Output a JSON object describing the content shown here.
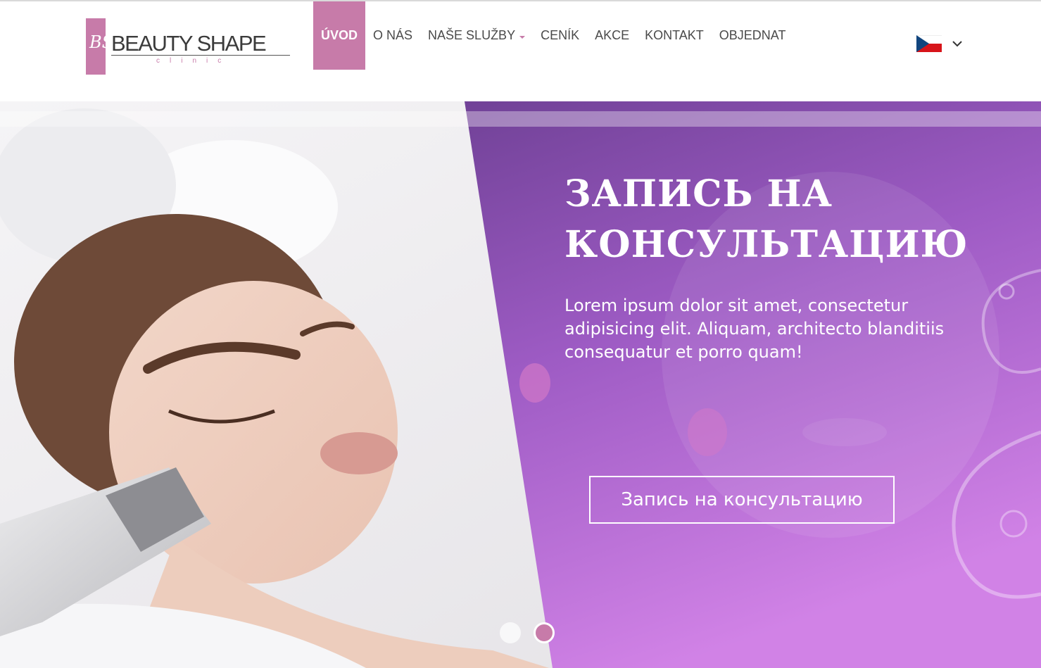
{
  "brand": {
    "monogram": "BS",
    "name": "BEAUTY SHAPE",
    "sub": "clinic",
    "accent_color": "#c77ba9"
  },
  "nav": {
    "items": [
      {
        "label": "ÚVOD",
        "active": true
      },
      {
        "label": "O NÁS"
      },
      {
        "label": "NAŠE SLUŽBY",
        "dropdown": true
      },
      {
        "label": "CENÍK"
      },
      {
        "label": "AKCE"
      },
      {
        "label": "KONTAKT"
      },
      {
        "label": "OBJEDNAT"
      }
    ]
  },
  "language": {
    "flag": "czech-flag-icon",
    "chevron": "chevron-down-icon"
  },
  "hero": {
    "title": "ЗАПИСЬ НА КОНСУЛЬТАЦИЮ",
    "text": "Lorem ipsum dolor sit amet, consectetur adipisicing elit. Aliquam, architecto blanditiis consequatur et porro quam!",
    "button": "Запись на консультацию",
    "overlay_color": "#8f47b8",
    "slides_total": 2,
    "active_slide": 2
  }
}
